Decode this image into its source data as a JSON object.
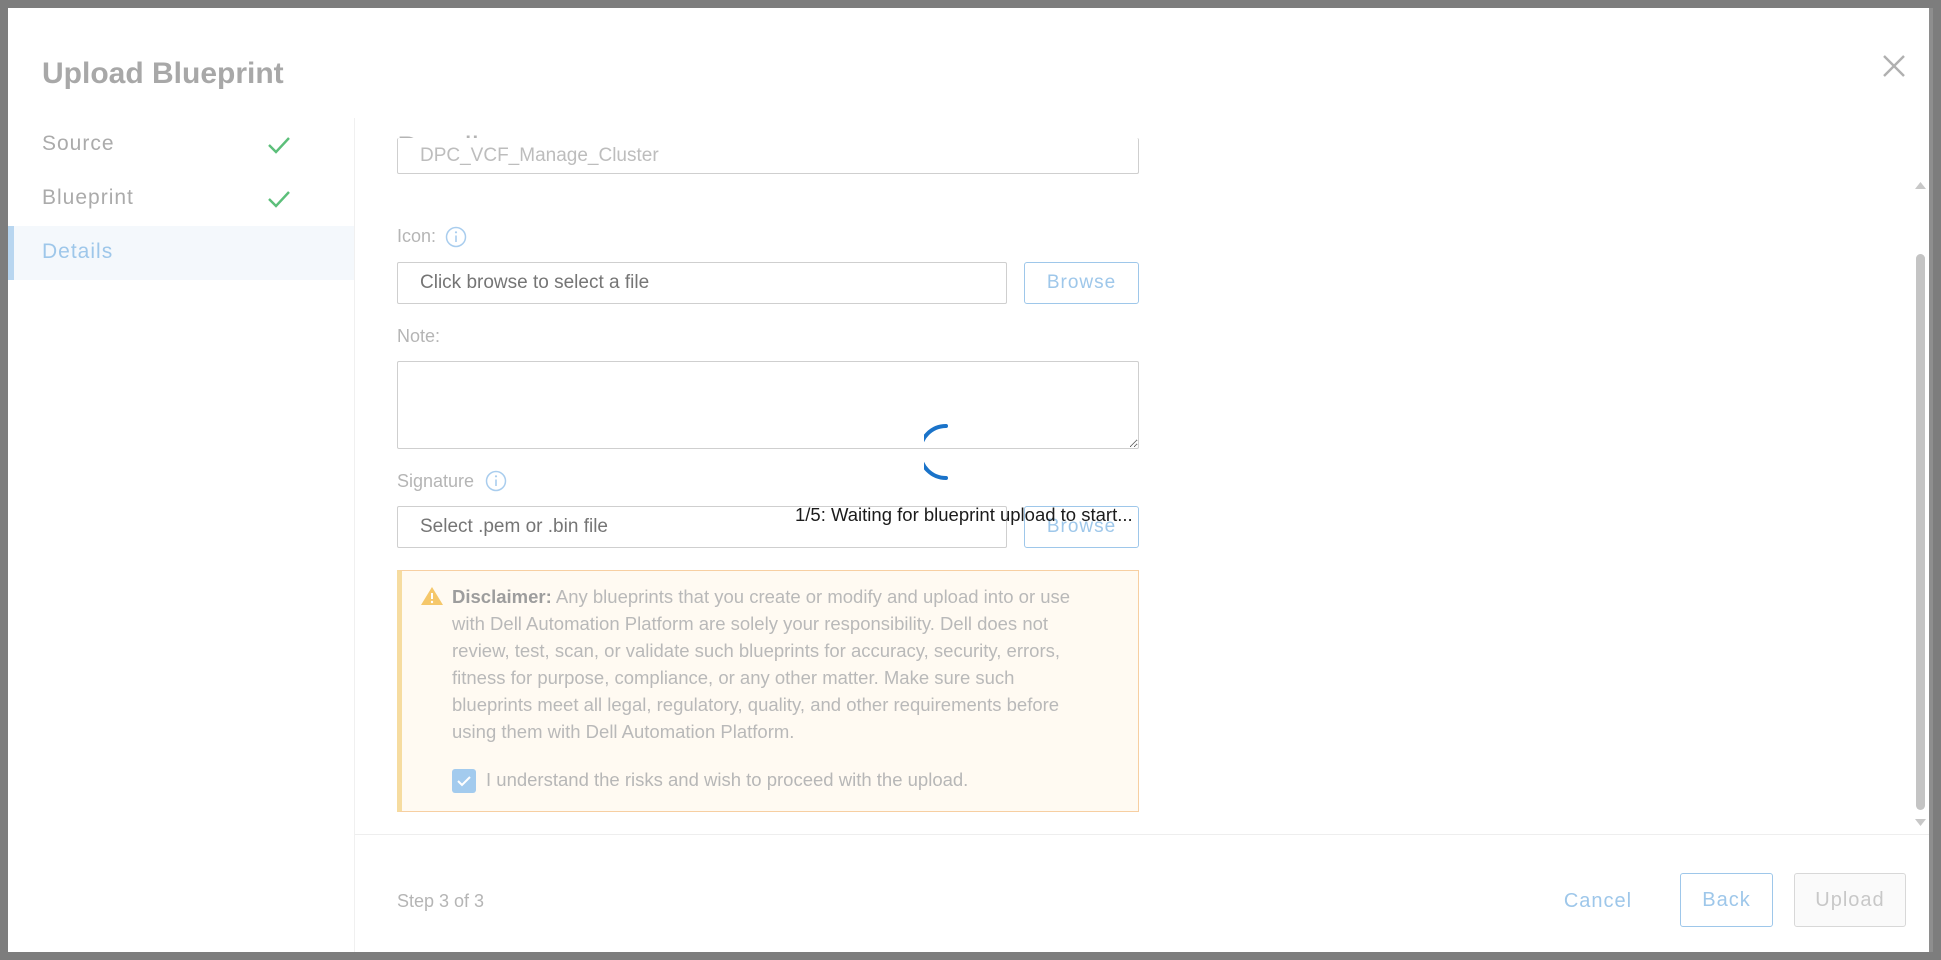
{
  "dialog": {
    "title": "Upload Blueprint",
    "close_icon": "close-icon"
  },
  "steps": [
    {
      "label": "Source",
      "completed": true,
      "active": false
    },
    {
      "label": "Blueprint",
      "completed": true,
      "active": false
    },
    {
      "label": "Details",
      "completed": false,
      "active": true
    }
  ],
  "details": {
    "section_title": "Details",
    "name_value": "DPC_VCF_Manage_Cluster",
    "icon": {
      "label": "Icon:",
      "placeholder": "Click browse to select a file",
      "browse_label": "Browse"
    },
    "note": {
      "label": "Note:",
      "value": ""
    },
    "signature": {
      "label": "Signature",
      "placeholder": "Select .pem or .bin file",
      "browse_label": "Browse"
    },
    "disclaimer": {
      "heading": "Disclaimer:",
      "body": " Any blueprints that you create or modify and upload into or use with Dell Automation Platform are solely your responsibility. Dell does not review, test, scan, or validate such blueprints for accuracy, security, errors, fitness for purpose, compliance, or any other matter. Make sure such blueprints meet all legal, regulatory, quality, and other requirements before using them with Dell Automation Platform.",
      "checkbox_label": "I understand the risks and wish to proceed with the upload.",
      "checked": true
    }
  },
  "footer": {
    "step_count": "Step 3 of 3",
    "cancel_label": "Cancel",
    "back_label": "Back",
    "upload_label": "Upload"
  },
  "loading": {
    "message": "1/5: Waiting for blueprint upload to start..."
  },
  "colors": {
    "accent": "#9ec7ea",
    "spinner": "#1a73c9",
    "warning_border": "#f7cfa2",
    "check_green": "#5cbf7a"
  }
}
